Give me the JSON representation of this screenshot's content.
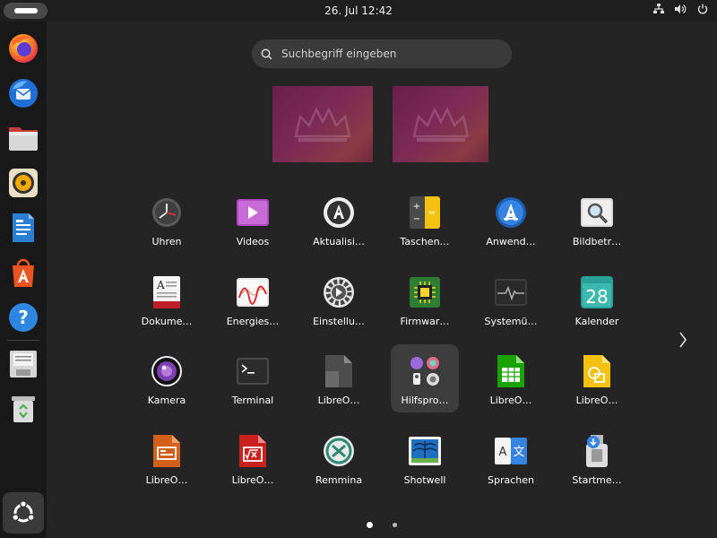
{
  "topbar": {
    "clock": "26. Jul  12:42"
  },
  "dock": {
    "items": [
      {
        "name": "firefox-icon"
      },
      {
        "name": "thunderbird-icon"
      },
      {
        "name": "files-icon"
      },
      {
        "name": "rhythmbox-icon"
      },
      {
        "name": "libreoffice-writer-icon"
      },
      {
        "name": "app-center-icon"
      },
      {
        "name": "help-icon"
      },
      {
        "name": "disk-install-icon"
      },
      {
        "name": "trash-icon"
      }
    ]
  },
  "search": {
    "placeholder": "Suchbegriff eingeben"
  },
  "apps": [
    {
      "label": "Uhren"
    },
    {
      "label": "Videos"
    },
    {
      "label": "Aktualisi…"
    },
    {
      "label": "Taschen…"
    },
    {
      "label": "Anwend…"
    },
    {
      "label": "Bildbetr…"
    },
    {
      "label": "Dokume…"
    },
    {
      "label": "Energies…"
    },
    {
      "label": "Einstellu…"
    },
    {
      "label": "Firmwar…"
    },
    {
      "label": "Systemü…"
    },
    {
      "label": "Kalender"
    },
    {
      "label": "Kamera"
    },
    {
      "label": "Terminal"
    },
    {
      "label": "LibreO…"
    },
    {
      "label": "Hilfspro…"
    },
    {
      "label": "LibreO…"
    },
    {
      "label": "LibreO…"
    },
    {
      "label": "LibreO…"
    },
    {
      "label": "LibreO…"
    },
    {
      "label": "Remmina"
    },
    {
      "label": "Shotwell"
    },
    {
      "label": "Sprachen"
    },
    {
      "label": "Startme…"
    }
  ],
  "calendar_day": "28",
  "colors": {
    "background": "#242424",
    "topbar": "#1e1e1e",
    "dock": "#181818",
    "ubuntu_orange": "#e95420"
  }
}
